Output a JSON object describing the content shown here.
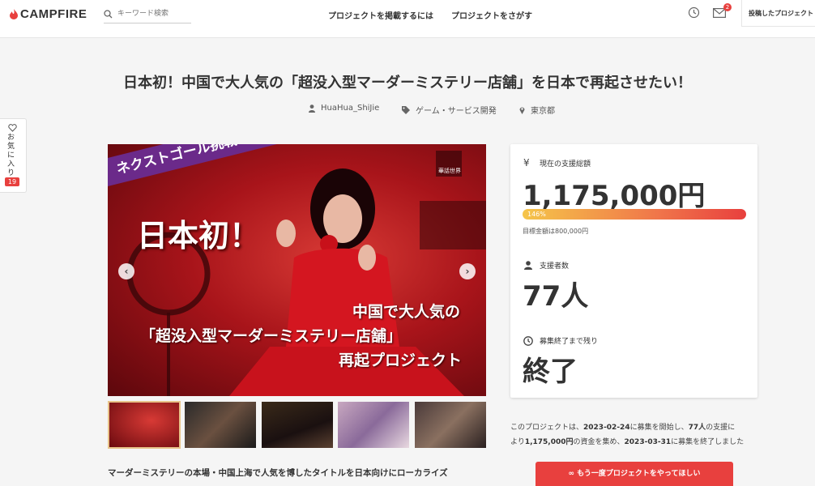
{
  "header": {
    "logo_text": "CAMPFIRE",
    "search_placeholder": "キーワード検索",
    "nav": [
      "プロジェクトを掲載するには",
      "プロジェクトをさがす"
    ],
    "notification_count": "2",
    "posted_projects": "投稿したプロジェクト"
  },
  "project": {
    "title": "日本初！中国で大人気の「超没入型マーダーミステリー店舗」を日本で再起させたい！",
    "owner": "HuaHua_ShiJie",
    "category": "ゲーム・サービス開発",
    "location": "東京都"
  },
  "favorite": {
    "label": "お気に入り",
    "count": "19"
  },
  "hero": {
    "banner": "ネクストゴール挑戦中！",
    "headline": "日本初！",
    "line1": "中国で大人気の",
    "line2": "「超没入型マーダーミステリー店舗」",
    "line3": "再起プロジェクト",
    "watermark": "華話世界"
  },
  "stats": {
    "total_label": "現在の支援総額",
    "total_value": "1,175,000円",
    "percent_label": "146%",
    "percent": 146,
    "goal_text": "目標金額は800,000円",
    "backers_label": "支援者数",
    "backers_value": "77人",
    "remaining_label": "募集終了まで残り",
    "remaining_value": "終了"
  },
  "summary": {
    "p1": "このプロジェクトは、",
    "start": "2023-02-24",
    "p2": "に募集を開始し、",
    "backers": "77人",
    "p3": "の支援に",
    "p4": "より",
    "amount": "1,175,000円",
    "p5": "の資金を集め、",
    "end": "2023-03-31",
    "p6": "に募集を終了しました"
  },
  "cta_label": "もう一度プロジェクトをやってほしい",
  "lead_text": "マーダーミステリーの本場・中国上海で人気を博したタイトルを日本向けにローカライズ",
  "colors": {
    "accent": "#e8403e",
    "banner": "#6b2a8a"
  }
}
